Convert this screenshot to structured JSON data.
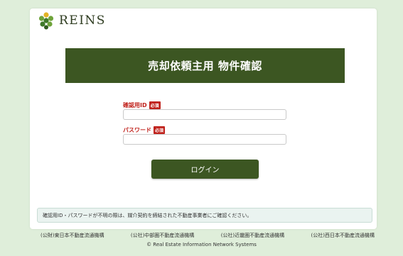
{
  "brand": {
    "name": "REINS",
    "logo_icon": "leaf-cluster-logo",
    "colors": {
      "primary": "#3c5622",
      "required": "#c0221c",
      "background": "#dfeeda"
    }
  },
  "banner": {
    "title": "売却依頼主用 物件確認"
  },
  "form": {
    "id_label": "確認用ID",
    "id_required": "必須",
    "id_value": "",
    "password_label": "パスワード",
    "password_required": "必須",
    "password_value": "",
    "login_label": "ログイン"
  },
  "notice": "確認用ID・パスワードが不明の際は、媒介契約を締結された不動産事業者にご確認ください。",
  "footer": {
    "orgs": [
      "(公財)東日本不動産流通機構",
      "(公社)中部圏不動産流通機構",
      "(公社)近畿圏不動産流通機構",
      "(公社)西日本不動産流通機構"
    ],
    "copyright": "© Real Estate Information Network Systems"
  }
}
